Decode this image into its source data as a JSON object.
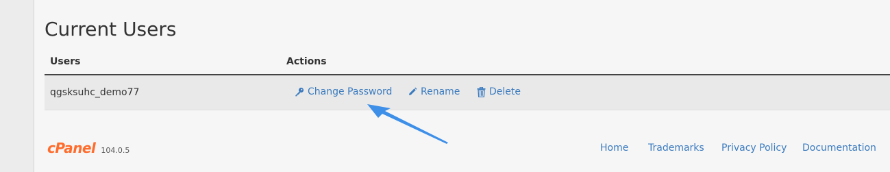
{
  "page": {
    "title": "Current Users"
  },
  "table": {
    "headers": {
      "users": "Users",
      "actions": "Actions"
    },
    "rows": [
      {
        "user": "qgsksuhc_demo77",
        "actions": {
          "change_password": "Change Password",
          "rename": "Rename",
          "delete": "Delete"
        }
      }
    ]
  },
  "footer": {
    "logo": "cPanel",
    "version": "104.0.5",
    "links": {
      "home": "Home",
      "trademarks": "Trademarks",
      "privacy": "Privacy Policy",
      "documentation": "Documentation"
    }
  },
  "colors": {
    "link": "#3b7bbf",
    "brand": "#ff6c2c",
    "annotation_arrow": "#3d8fe8"
  },
  "icons": {
    "change_password": "key-icon",
    "rename": "pencil-icon",
    "delete": "trash-icon"
  }
}
